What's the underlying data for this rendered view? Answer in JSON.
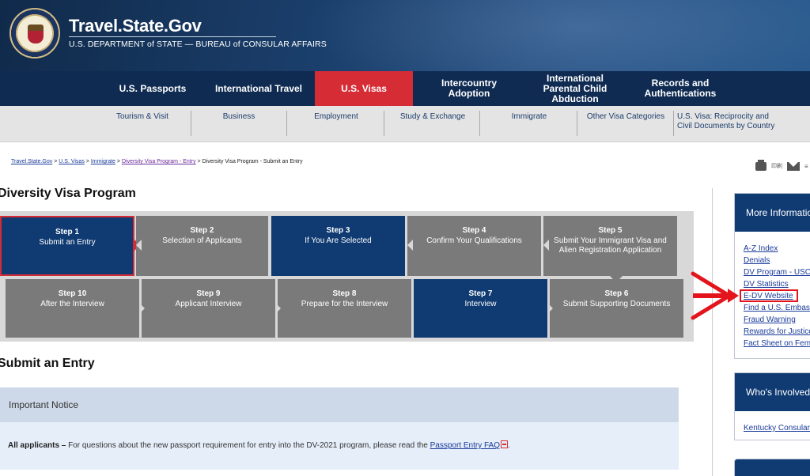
{
  "header": {
    "title": "Travel.State.Gov",
    "subtitle": "U.S. DEPARTMENT of STATE — BUREAU of CONSULAR AFFAIRS"
  },
  "main_nav": [
    {
      "label": "U.S. Passports"
    },
    {
      "label": "International Travel"
    },
    {
      "label": "U.S. Visas"
    },
    {
      "label": "Intercountry Adoption"
    },
    {
      "label": "International Parental Child Abduction"
    },
    {
      "label": "Records and Authentications"
    }
  ],
  "sub_nav": [
    {
      "label": "Tourism & Visit"
    },
    {
      "label": "Business"
    },
    {
      "label": "Employment"
    },
    {
      "label": "Study & Exchange"
    },
    {
      "label": "Immigrate"
    },
    {
      "label": "Other Visa Categories"
    },
    {
      "label": "U.S. Visa: Reciprocity and Civil Documents by Country"
    }
  ],
  "breadcrumb": {
    "items": [
      "Travel.State.Gov",
      "U.S. Visas",
      "Immigrate",
      "Diversity Visa Program - Entry"
    ],
    "separator": ">",
    "current": "Diversity Visa Program - Submit an Entry"
  },
  "utility": {
    "print_label": "印刷",
    "more_label": "≡"
  },
  "page_title": "Diversity Visa Program",
  "steps": [
    {
      "number": "Step 1",
      "label": "Submit an Entry"
    },
    {
      "number": "Step 2",
      "label": "Selection of Applicants"
    },
    {
      "number": "Step 3",
      "label": "If You Are Selected"
    },
    {
      "number": "Step 4",
      "label": "Confirm Your Qualifications"
    },
    {
      "number": "Step 5",
      "label": "Submit Your Immigrant Visa and Alien Registration Application"
    },
    {
      "number": "Step 6",
      "label": "Submit Supporting Documents"
    },
    {
      "number": "Step 7",
      "label": "Interview"
    },
    {
      "number": "Step 8",
      "label": "Prepare for the Interview"
    },
    {
      "number": "Step 9",
      "label": "Applicant Interview"
    },
    {
      "number": "Step 10",
      "label": "After the Interview"
    }
  ],
  "section_title": "Submit an Entry",
  "notice": {
    "heading": "Important Notice",
    "lead": "All applicants –",
    "text": "For questions about the new passport requirement for entry into the DV-2021 program, please read the",
    "link": "Passport Entry FAQ",
    "end": "."
  },
  "sidebar": {
    "more_info": {
      "heading": "More Information",
      "links": [
        "A-Z Index",
        "Denials",
        "DV Program - USCIS",
        "DV Statistics",
        "E-DV Website",
        "Find a U.S. Embassy",
        "Fraud Warning",
        "Rewards for Justice",
        "Fact Sheet on Female"
      ]
    },
    "whos_involved": {
      "heading": "Who's Involved",
      "links": [
        "Kentucky Consular Center"
      ]
    }
  },
  "colors": {
    "navy": "#0f2b52",
    "step_blue": "#0f3a72",
    "step_gray": "#7a7a7a",
    "accent_red": "#d62c35",
    "highlight_red": "#e3141c"
  }
}
